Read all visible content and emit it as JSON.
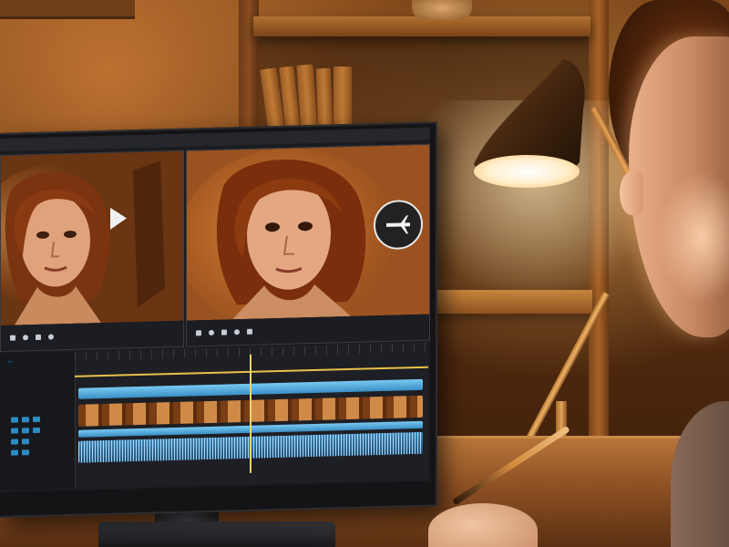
{
  "scene": {
    "description_colors": {
      "wall_warm": "#7a4418",
      "lamp_light": "#fff0cf",
      "desk_wood": "#b97639",
      "monitor_bezel": "#141416",
      "timeline_accent": "#e8c14a",
      "clip_blue": "#79c9f2"
    }
  },
  "editor": {
    "menu": [
      "",
      "",
      "",
      "",
      "",
      "",
      "",
      "",
      ""
    ],
    "source_preview": {
      "timecode": "",
      "play_icon": "play-icon"
    },
    "program_preview": {
      "timecode": "",
      "play_icon": "play-icon"
    },
    "timeline": {
      "track_label": ""
    }
  }
}
